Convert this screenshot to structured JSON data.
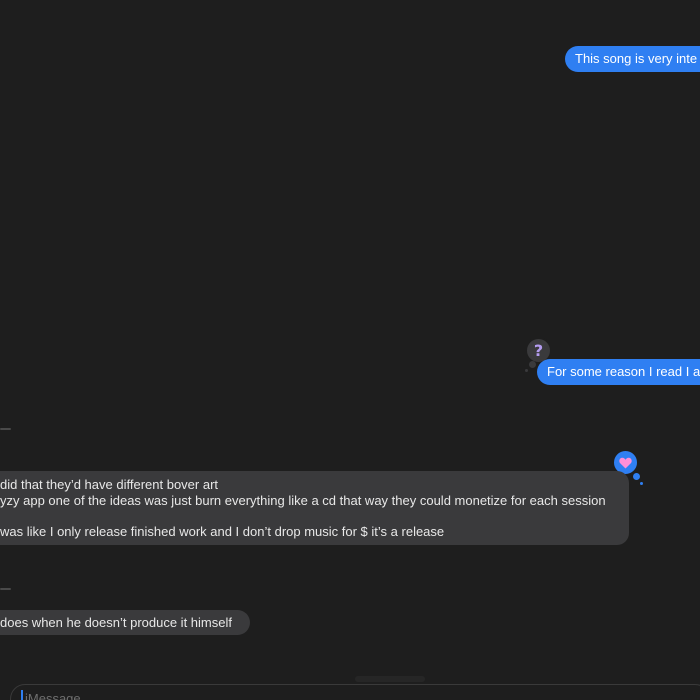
{
  "conversation": {
    "messages": [
      {
        "id": "m1",
        "direction": "outgoing",
        "text": "This song is very inte"
      },
      {
        "id": "m2",
        "direction": "outgoing",
        "text": "For some reason I read I as",
        "tapback": "question"
      },
      {
        "id": "m3",
        "direction": "incoming",
        "lines": [
          "did that they’d have different bover art",
          "yzy app one of the ideas was just burn everything like a cd that way they could monetize for each session",
          "",
          "was like I only release finished work and I don’t drop music for $ it’s a release"
        ],
        "tapback": "heart"
      },
      {
        "id": "m4",
        "direction": "incoming",
        "text": "does when he doesn’t produce it himself"
      }
    ],
    "tapbacks": {
      "question_glyph": "?",
      "heart_color": "#ff8fd8"
    }
  },
  "composer": {
    "placeholder": "iMessage"
  },
  "colors": {
    "background": "#1e1e1e",
    "outgoing_bubble": "#2f7ff2",
    "incoming_bubble": "#3a3a3c",
    "question_glyph": "#b49cf0"
  }
}
